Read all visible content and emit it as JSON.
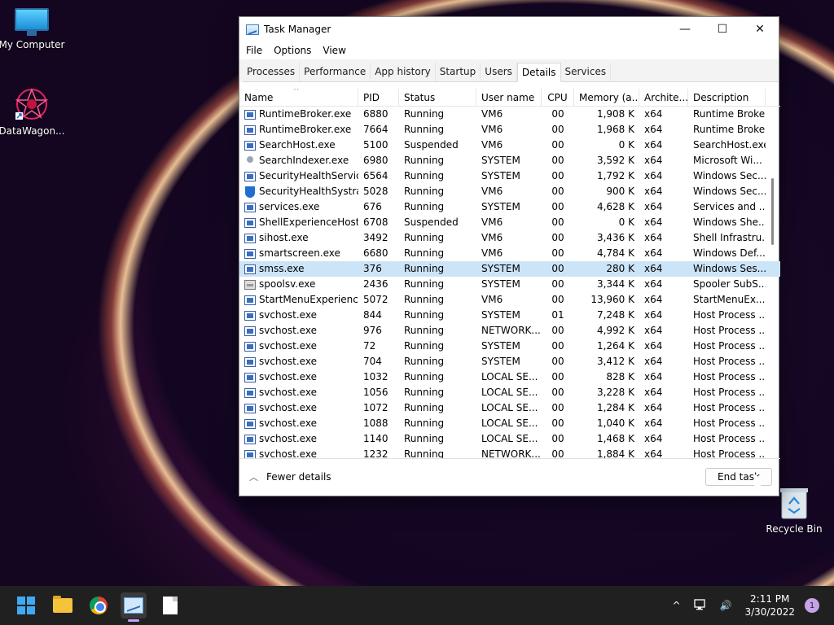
{
  "desktop": {
    "icons": [
      {
        "label": "My Computer"
      },
      {
        "label": "DataWagon..."
      },
      {
        "label": "Recycle Bin"
      }
    ]
  },
  "window": {
    "title": "Task Manager",
    "controls": {
      "minimize": "—",
      "maximize": "☐",
      "close": "✕"
    },
    "menu": [
      "File",
      "Options",
      "View"
    ],
    "tabs": [
      "Processes",
      "Performance",
      "App history",
      "Startup",
      "Users",
      "Details",
      "Services"
    ],
    "active_tab": "Details",
    "columns": [
      "Name",
      "PID",
      "Status",
      "User name",
      "CPU",
      "Memory (a...",
      "Archite...",
      "Description"
    ],
    "rows": [
      {
        "icon": "app",
        "name": "RuntimeBroker.exe",
        "pid": "6880",
        "status": "Running",
        "user": "VM6",
        "cpu": "00",
        "mem": "1,908 K",
        "arch": "x64",
        "desc": "Runtime Broker"
      },
      {
        "icon": "app",
        "name": "RuntimeBroker.exe",
        "pid": "7664",
        "status": "Running",
        "user": "VM6",
        "cpu": "00",
        "mem": "1,968 K",
        "arch": "x64",
        "desc": "Runtime Broker"
      },
      {
        "icon": "app",
        "name": "SearchHost.exe",
        "pid": "5100",
        "status": "Suspended",
        "user": "VM6",
        "cpu": "00",
        "mem": "0 K",
        "arch": "x64",
        "desc": "SearchHost.exe"
      },
      {
        "icon": "person",
        "name": "SearchIndexer.exe",
        "pid": "6980",
        "status": "Running",
        "user": "SYSTEM",
        "cpu": "00",
        "mem": "3,592 K",
        "arch": "x64",
        "desc": "Microsoft Wi..."
      },
      {
        "icon": "app",
        "name": "SecurityHealthServic...",
        "pid": "6564",
        "status": "Running",
        "user": "SYSTEM",
        "cpu": "00",
        "mem": "1,792 K",
        "arch": "x64",
        "desc": "Windows Sec..."
      },
      {
        "icon": "shield",
        "name": "SecurityHealthSystra...",
        "pid": "5028",
        "status": "Running",
        "user": "VM6",
        "cpu": "00",
        "mem": "900 K",
        "arch": "x64",
        "desc": "Windows Sec..."
      },
      {
        "icon": "app",
        "name": "services.exe",
        "pid": "676",
        "status": "Running",
        "user": "SYSTEM",
        "cpu": "00",
        "mem": "4,628 K",
        "arch": "x64",
        "desc": "Services and ..."
      },
      {
        "icon": "app",
        "name": "ShellExperienceHost....",
        "pid": "6708",
        "status": "Suspended",
        "user": "VM6",
        "cpu": "00",
        "mem": "0 K",
        "arch": "x64",
        "desc": "Windows She..."
      },
      {
        "icon": "app",
        "name": "sihost.exe",
        "pid": "3492",
        "status": "Running",
        "user": "VM6",
        "cpu": "00",
        "mem": "3,436 K",
        "arch": "x64",
        "desc": "Shell Infrastru..."
      },
      {
        "icon": "app",
        "name": "smartscreen.exe",
        "pid": "6680",
        "status": "Running",
        "user": "VM6",
        "cpu": "00",
        "mem": "4,784 K",
        "arch": "x64",
        "desc": "Windows Def..."
      },
      {
        "icon": "app",
        "name": "smss.exe",
        "pid": "376",
        "status": "Running",
        "user": "SYSTEM",
        "cpu": "00",
        "mem": "280 K",
        "arch": "x64",
        "desc": "Windows Ses...",
        "selected": true
      },
      {
        "icon": "printer",
        "name": "spoolsv.exe",
        "pid": "2436",
        "status": "Running",
        "user": "SYSTEM",
        "cpu": "00",
        "mem": "3,344 K",
        "arch": "x64",
        "desc": "Spooler SubS..."
      },
      {
        "icon": "app",
        "name": "StartMenuExperienc...",
        "pid": "5072",
        "status": "Running",
        "user": "VM6",
        "cpu": "00",
        "mem": "13,960 K",
        "arch": "x64",
        "desc": "StartMenuEx..."
      },
      {
        "icon": "app",
        "name": "svchost.exe",
        "pid": "844",
        "status": "Running",
        "user": "SYSTEM",
        "cpu": "01",
        "mem": "7,248 K",
        "arch": "x64",
        "desc": "Host Process ..."
      },
      {
        "icon": "app",
        "name": "svchost.exe",
        "pid": "976",
        "status": "Running",
        "user": "NETWORK...",
        "cpu": "00",
        "mem": "4,992 K",
        "arch": "x64",
        "desc": "Host Process ..."
      },
      {
        "icon": "app",
        "name": "svchost.exe",
        "pid": "72",
        "status": "Running",
        "user": "SYSTEM",
        "cpu": "00",
        "mem": "1,264 K",
        "arch": "x64",
        "desc": "Host Process ..."
      },
      {
        "icon": "app",
        "name": "svchost.exe",
        "pid": "704",
        "status": "Running",
        "user": "SYSTEM",
        "cpu": "00",
        "mem": "3,412 K",
        "arch": "x64",
        "desc": "Host Process ..."
      },
      {
        "icon": "app",
        "name": "svchost.exe",
        "pid": "1032",
        "status": "Running",
        "user": "LOCAL SE...",
        "cpu": "00",
        "mem": "828 K",
        "arch": "x64",
        "desc": "Host Process ..."
      },
      {
        "icon": "app",
        "name": "svchost.exe",
        "pid": "1056",
        "status": "Running",
        "user": "LOCAL SE...",
        "cpu": "00",
        "mem": "3,228 K",
        "arch": "x64",
        "desc": "Host Process ..."
      },
      {
        "icon": "app",
        "name": "svchost.exe",
        "pid": "1072",
        "status": "Running",
        "user": "LOCAL SE...",
        "cpu": "00",
        "mem": "1,284 K",
        "arch": "x64",
        "desc": "Host Process ..."
      },
      {
        "icon": "app",
        "name": "svchost.exe",
        "pid": "1088",
        "status": "Running",
        "user": "LOCAL SE...",
        "cpu": "00",
        "mem": "1,040 K",
        "arch": "x64",
        "desc": "Host Process ..."
      },
      {
        "icon": "app",
        "name": "svchost.exe",
        "pid": "1140",
        "status": "Running",
        "user": "LOCAL SE...",
        "cpu": "00",
        "mem": "1,468 K",
        "arch": "x64",
        "desc": "Host Process ..."
      },
      {
        "icon": "app",
        "name": "svchost.exe",
        "pid": "1232",
        "status": "Running",
        "user": "NETWORK...",
        "cpu": "00",
        "mem": "1,884 K",
        "arch": "x64",
        "desc": "Host Process ..."
      }
    ],
    "footer": {
      "fewer_details": "Fewer details",
      "end_task": "End task"
    }
  },
  "taskbar": {
    "clock_time": "2:11 PM",
    "clock_date": "3/30/2022",
    "notification_count": "1",
    "tray_chevron": "^",
    "volume_glyph": "🔊"
  },
  "colors": {
    "selection": "#cce4f7",
    "taskbar": "#202020",
    "accent": "#3fa9f5"
  }
}
